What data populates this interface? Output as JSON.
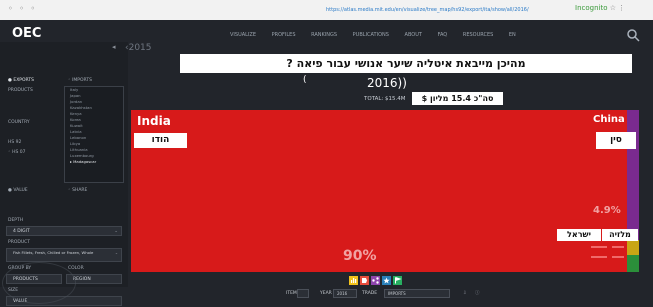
{
  "browser": {
    "controls": "◦ ◦ ◦",
    "url": "https://atlas.media.mit.edu/en/visualize/tree_map/hs92/export/ita/show/all/2016/",
    "right_text": "Incognito",
    "right_icons": "☆ ⋮"
  },
  "app": {
    "logo": "OEC",
    "nav": [
      "VISUALIZE",
      "PROFILES",
      "RANKINGS",
      "PUBLICATIONS",
      "ABOUT",
      "FAQ",
      "RESOURCES",
      "EN"
    ],
    "year_label": "‹2015",
    "year_arrow": "◂"
  },
  "sidebar": {
    "filters": [
      "● EXPORTS",
      "◦ IMPORTS",
      "PRODUCTS",
      "COUNTRY",
      "HS 92",
      "◦ HS 07"
    ],
    "list_items": [
      "Italy",
      "Japan",
      "Jordan",
      "Kazakhstan",
      "Kenya",
      "Korea",
      "Kuwait",
      "Latvia",
      "Lebanon",
      "Libya",
      "Lithuania",
      "Luxembourg",
      "▸ Madagascar"
    ],
    "radio_a": "● VALUE",
    "radio_b": "◦ SHARE",
    "depth_label": "DEPTH",
    "depth_value": "4 DIGIT",
    "product_label": "PRODUCT",
    "product_value": "Fish Fillets, Fresh, Chilled or Frozen, Whole",
    "col_a_label": "GROUP BY",
    "col_b_label": "COLOR",
    "col_a_value": "PRODUCTS",
    "col_b_value": "REGION",
    "last_label": "SIZE",
    "last_value": "VALUE"
  },
  "chart_header": {
    "hebrew_title": "מהיכן מייבאת איטליה שיער אנושי עבור פיאה ?",
    "paren_open": "(",
    "year": "2016))",
    "total": "TOTAL: $15.4M",
    "hebrew_total": "סה\"כ 15.4 מליון $"
  },
  "chart_data": {
    "type": "treemap",
    "items": [
      {
        "name": "India",
        "hebrew": "הודו",
        "share_pct": 90,
        "color": "#d71a1a"
      },
      {
        "name": "China",
        "hebrew": "סין",
        "share_pct": 4.9,
        "color": "#d71a1a"
      },
      {
        "name": "",
        "hebrew": "ישראל",
        "share_pct": null,
        "color": "#d71a1a"
      },
      {
        "name": "",
        "hebrew": "מלזיה",
        "share_pct": null,
        "color": "#d71a1a"
      }
    ],
    "labels_shown": {
      "india_pct": "90%",
      "china_pct": "4.9%"
    }
  },
  "bottom_bar": {
    "icons": [
      "bar-chart-icon",
      "tag-icon",
      "share-icon",
      "star-icon",
      "flag-icon"
    ],
    "icon_colors": [
      "#f2c21b",
      "#e74c3c",
      "#8e44ad",
      "#2980b9",
      "#27ae60"
    ],
    "label_a": "ITEM",
    "label_b": "YEAR",
    "year_value": "2016",
    "trade_label": "TRADE",
    "trade_value": "IMPORTS"
  }
}
